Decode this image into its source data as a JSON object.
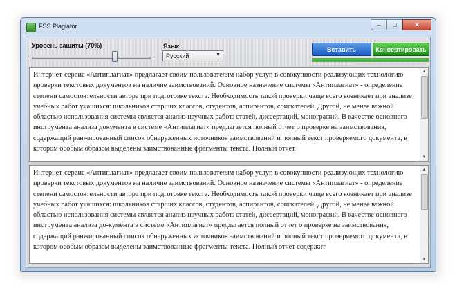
{
  "window": {
    "title": "FSS Plagiator",
    "min_label": "–",
    "max_label": "□",
    "close_label": "✕"
  },
  "controls": {
    "protection_label": "Уровень защиты (70%)",
    "protection_level_percent": 70,
    "language_label": "Язык",
    "language_value": "Русский",
    "insert_label": "Вставить",
    "convert_label": "Конвертировать",
    "progress_percent": 100
  },
  "input_text": "Интернет-сервис «Антиплагиат» предлагает своим пользователям набор услуг, в совокупности реализующих технологию проверки текстовых документов на наличие заимствований. Основное назначение системы «Антиплагиат» - определение степени самостоятельности автора при подготовке текста. Необходимость такой проверки чаще всего возникает при анализе учебных работ учащихся: школьников старших классов, студентов, аспирантов, соискателей. Другой, не менее важной областью использования системы является анализ научных работ: статей, диссертаций, монографий. В качестве основного инструмента анализа документа в системе «Антиплагиат» предлагается полный отчет о проверке на заимствования, содержащий ранжированный список обнаруженных источников заимствований и полный текст проверяемого документа, в котором особым образом выделены заимствованные фрагменты текста. Полный отчет",
  "output_text": "Интернет-сервис «Антиплагиат» предлагает своим пользователям набор услуг, в совокупности реализующих технологию проверки текстовых документов на наличие заимствований. Основное назначение системы «Антиплагиат» - определение степени самостоятельности автора при подготовке текста. Необходимость такой проверки чаще всего возникает при анализе учебных работ учащихся: школьников старших классов, студентов, аспирантов, соискателей. Другой, не менее важной областью использования системы является анализ научных работ: статей, диссертаций, монографий. В качестве основного инструмента анализа до-кумента в системе «Антиплагиат» предлагается полный отчет о проверке на заимствования, содержащий ранжированный список обнаруженных источников заимствований и полный текст проверяемого документа, в котором особым образом выделены заимствованные фрагменты текста. Полный отчет содержит"
}
